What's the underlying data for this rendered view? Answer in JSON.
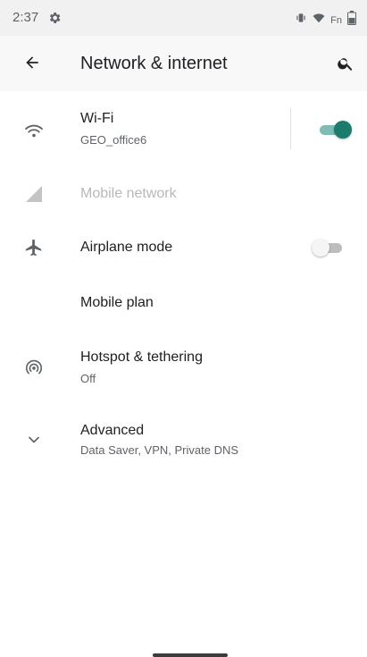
{
  "status_bar": {
    "time": "2:37",
    "carrier_label": "Fn"
  },
  "header": {
    "title": "Network & internet"
  },
  "items": [
    {
      "title": "Wi-Fi",
      "subtitle": "GEO_office6",
      "icon": "wifi-icon",
      "toggle": "on"
    },
    {
      "title": "Mobile network",
      "icon": "signal-icon",
      "disabled": true
    },
    {
      "title": "Airplane mode",
      "icon": "airplane-icon",
      "toggle": "off"
    },
    {
      "title": "Mobile plan"
    },
    {
      "title": "Hotspot & tethering",
      "subtitle": "Off",
      "icon": "hotspot-icon"
    },
    {
      "title": "Advanced",
      "subtitle": "Data Saver, VPN, Private DNS",
      "icon": "chevron-down-icon"
    }
  ],
  "colors": {
    "accent": "#1b7c6e",
    "toggle_track_on": "#7fbcb3",
    "status_bar_bg": "#f1f1f1",
    "app_bar_bg": "#f8f8f8",
    "disabled_text": "#b8b8b8"
  }
}
